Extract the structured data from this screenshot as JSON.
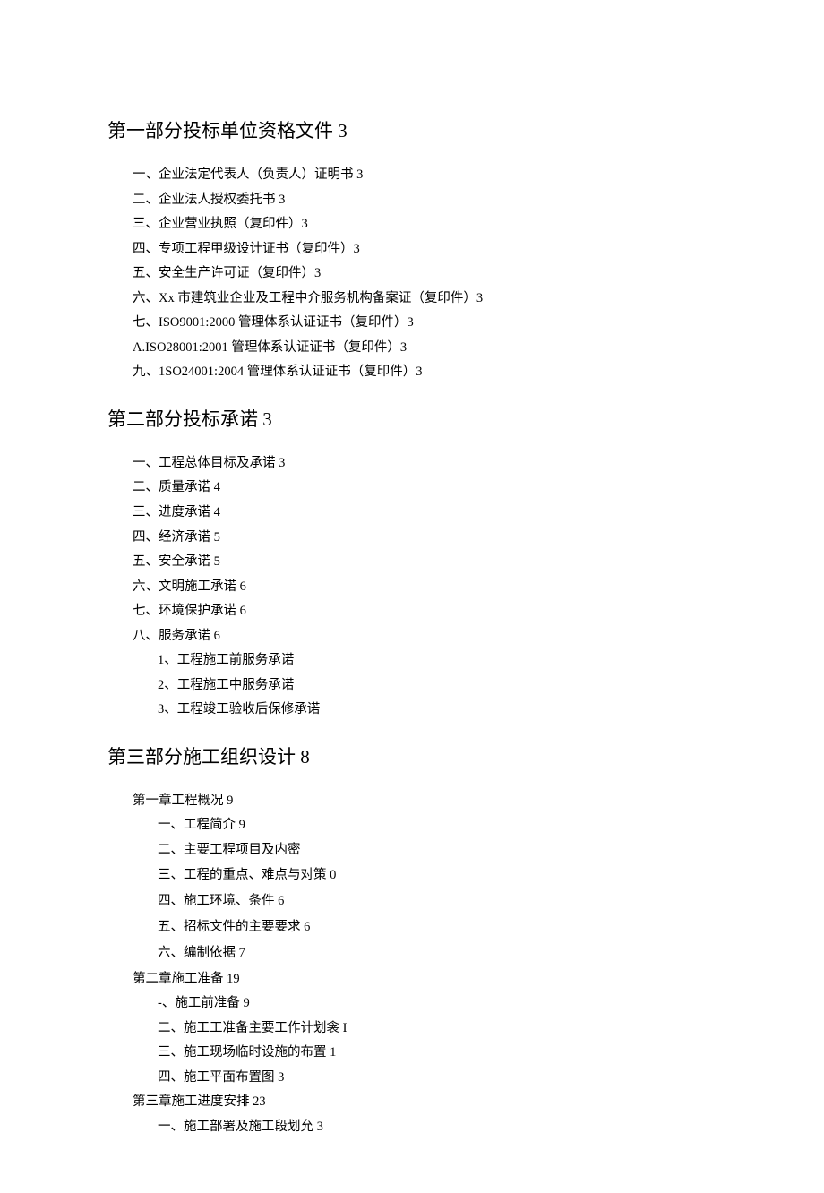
{
  "sections": [
    {
      "title": "第一部分投标单位资格文件 3",
      "items": [
        {
          "text": "一、企业法定代表人（负责人）证明书 3"
        },
        {
          "text": "二、企业法人授权委托书 3"
        },
        {
          "text": "三、企业营业执照（复印件）3"
        },
        {
          "text": "四、专项工程甲级设计证书（复印件）3"
        },
        {
          "text": "五、安全生产许可证（复印件）3"
        },
        {
          "text": "六、Xx 市建筑业企业及工程中介服务机构备案证（复印件）3"
        },
        {
          "text": "七、ISO9001:2000 管理体系认证证书（复印件）3"
        },
        {
          "text": "A.ISO28001:2001 管理体系认证证书（复印件）3"
        },
        {
          "text": "九、1SO24001:2004 管理体系认证证书（复印件）3"
        }
      ]
    },
    {
      "title": "第二部分投标承诺 3",
      "items": [
        {
          "text": "一、工程总体目标及承诺 3"
        },
        {
          "text": "二、质量承诺 4"
        },
        {
          "text": "三、进度承诺 4"
        },
        {
          "text": "四、经济承诺 5"
        },
        {
          "text": "五、安全承诺 5"
        },
        {
          "text": "六、文明施工承诺 6"
        },
        {
          "text": "七、环境保护承诺 6"
        },
        {
          "text": "八、服务承诺 6",
          "children": [
            {
              "text": "1、工程施工前服务承诺"
            },
            {
              "text": "2、工程施工中服务承诺"
            },
            {
              "text": "3、工程竣工验收后保修承诺"
            }
          ]
        }
      ]
    },
    {
      "title": "第三部分施工组织设计 8",
      "items": [
        {
          "text": "第一章工程概况 9",
          "children": [
            {
              "text": "一、工程简介 9"
            },
            {
              "text": "二、主要工程项目及内密"
            },
            {
              "text": "三、工程的重点、难点与对策 0"
            },
            {
              "text": "四、施工环境、条件 6",
              "spaced": true
            },
            {
              "text": "五、招标文件的主要要求 6"
            },
            {
              "text": "六、编制依据 7",
              "spaced": true
            }
          ]
        },
        {
          "text": "第二章施工准备 19",
          "children": [
            {
              "text": "-、施工前准备 9"
            },
            {
              "text": "二、施工工准备主要工作计划衾 I"
            },
            {
              "text": "三、施工现场临时设施的布置 1"
            },
            {
              "text": "四、施工平面布置图 3"
            }
          ]
        },
        {
          "text": "第三章施工进度安排 23",
          "children": [
            {
              "text": "一、施工部署及施工段划允 3"
            }
          ]
        }
      ]
    }
  ]
}
